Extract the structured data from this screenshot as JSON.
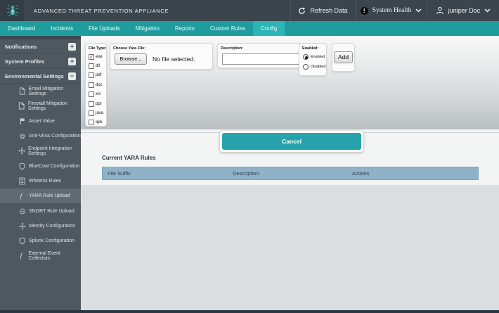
{
  "topbar": {
    "title": "ADVANCED THREAT PREVENTION APPLIANCE",
    "refresh_label": "Refresh Data",
    "health_icon_glyph": "!",
    "system_health_label": "System Health",
    "user_label": "juniper Doc"
  },
  "nav": {
    "tabs": [
      {
        "label": "Dashboard"
      },
      {
        "label": "Incidents"
      },
      {
        "label": "File Uploads"
      },
      {
        "label": "Mitigation"
      },
      {
        "label": "Reports"
      },
      {
        "label": "Custom Rules"
      },
      {
        "label": "Config",
        "active": true
      }
    ]
  },
  "sidebar": {
    "groups": [
      {
        "label": "Notifications",
        "expander": "+"
      },
      {
        "label": "System Profiles",
        "expander": "+"
      },
      {
        "label": "Environmental Settings",
        "expander": "−"
      }
    ],
    "items": [
      {
        "label": "Email Mitigation Settings",
        "icon": "document-icon"
      },
      {
        "label": "Firewall Mitigation Settings",
        "icon": "document-icon"
      },
      {
        "label": "Asset Value",
        "icon": "flag-icon"
      },
      {
        "label": "Anti-Virus Configuration",
        "icon": "bug-icon"
      },
      {
        "label": "Endpoint Integration Settings",
        "icon": "endpoint-icon"
      },
      {
        "label": "BlueCoat Configuration",
        "icon": "shield-icon"
      },
      {
        "label": "Whitelist Rules",
        "icon": "list-icon"
      },
      {
        "label": "YARA Rule Upload",
        "icon": "script-f-icon",
        "selected": true
      },
      {
        "label": "SNORT Rule Upload",
        "icon": "snort-icon"
      },
      {
        "label": "Identity Configuration",
        "icon": "move-arrows-icon"
      },
      {
        "label": "Splunk Configuration",
        "icon": "shield-icon"
      },
      {
        "label": "External Event Collectors",
        "icon": "script-f-icon"
      }
    ]
  },
  "form": {
    "file_type": {
      "label": "File Type:",
      "options": [
        {
          "label": "exe",
          "checked": true
        },
        {
          "label": "dll",
          "checked": false
        },
        {
          "label": "pdf",
          "checked": false
        },
        {
          "label": "doc",
          "checked": false
        },
        {
          "label": "xls",
          "checked": false
        },
        {
          "label": "ppt",
          "checked": false
        },
        {
          "label": "java",
          "checked": false
        },
        {
          "label": "apk",
          "checked": false
        }
      ],
      "check_glyph": "✓"
    },
    "choose_file": {
      "label": "Choose Yara File:",
      "browse_label": "Browse...",
      "status": "No file selected."
    },
    "description": {
      "label": "Description:",
      "value": ""
    },
    "enabled": {
      "label": "Enabled:",
      "options": [
        {
          "label": "Enabled",
          "selected": true
        },
        {
          "label": "Disabled",
          "selected": false
        }
      ]
    },
    "add_label": "Add",
    "cancel_label": "Cancel"
  },
  "rules_section": {
    "title": "Current YARA Rules",
    "columns": [
      "File Suffix",
      "Description",
      "Actions"
    ],
    "rows": []
  },
  "colors": {
    "topbar": "#3a454e",
    "nav_teal": "#1f9d9e",
    "nav_active_teal": "#2db4b5",
    "sidebar": "#4e5861",
    "sidebar_selected": "#5f6a73",
    "cancel_teal": "#28a3ab",
    "table_header_blue": "#90b2c9",
    "bottom_strip": "#2d3741"
  }
}
